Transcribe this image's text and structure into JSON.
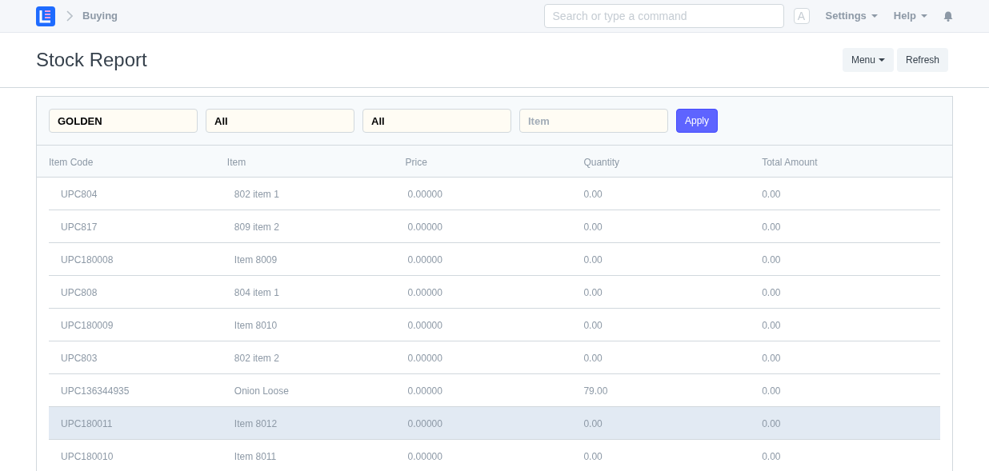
{
  "navbar": {
    "breadcrumb": "Buying",
    "search": {
      "placeholder": "Search or type a command"
    },
    "avatar": "A",
    "menus": [
      "Settings",
      "Help"
    ]
  },
  "page": {
    "title": "Stock Report",
    "buttons": [
      {
        "label": "Menu",
        "kind": "dropdown"
      },
      {
        "label": "Refresh",
        "kind": "plain"
      }
    ]
  },
  "filters": [
    {
      "value": "GOLDEN"
    },
    {
      "value": "All"
    },
    {
      "value": "All"
    },
    {
      "placeholder": "Item"
    }
  ],
  "apply_button": "Apply",
  "table": {
    "columns": [
      "Item Code",
      "Item",
      "Price",
      "Quantity",
      "Total Amount"
    ],
    "rows": [
      {
        "cells": [
          "UPC804",
          "802 item 1",
          "0.00000",
          "0.00",
          "0.00"
        ],
        "selected": false
      },
      {
        "cells": [
          "UPC817",
          "809 item 2",
          "0.00000",
          "0.00",
          "0.00"
        ],
        "selected": false
      },
      {
        "cells": [
          "UPC180008",
          "Item 8009",
          "0.00000",
          "0.00",
          "0.00"
        ],
        "selected": false
      },
      {
        "cells": [
          "UPC808",
          "804 item 1",
          "0.00000",
          "0.00",
          "0.00"
        ],
        "selected": false
      },
      {
        "cells": [
          "UPC180009",
          "Item 8010",
          "0.00000",
          "0.00",
          "0.00"
        ],
        "selected": false
      },
      {
        "cells": [
          "UPC803",
          "802 item 2",
          "0.00000",
          "0.00",
          "0.00"
        ],
        "selected": false
      },
      {
        "cells": [
          "UPC136344935",
          "Onion Loose",
          "0.00000",
          "79.00",
          "0.00"
        ],
        "selected": false
      },
      {
        "cells": [
          "UPC180011",
          "Item 8012",
          "0.00000",
          "0.00",
          "0.00"
        ],
        "selected": true
      },
      {
        "cells": [
          "UPC180010",
          "Item 8011",
          "0.00000",
          "0.00",
          "0.00"
        ],
        "selected": false
      }
    ]
  }
}
